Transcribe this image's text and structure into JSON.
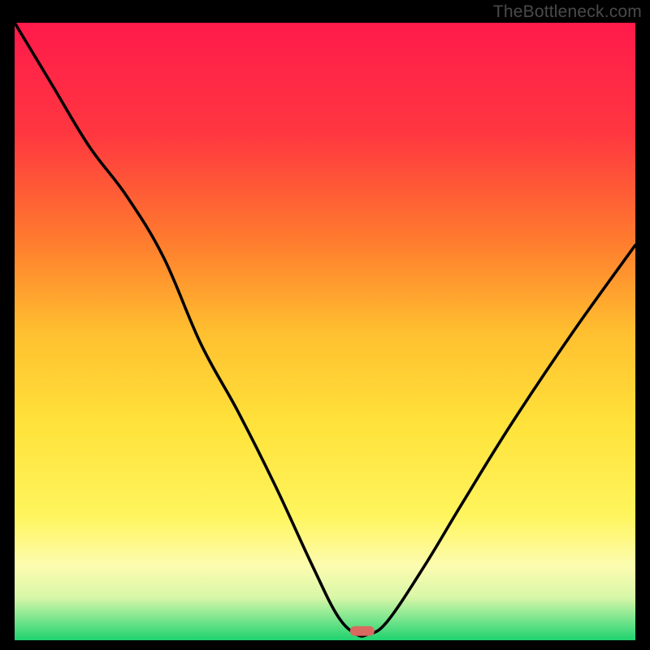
{
  "watermark": "TheBottleneck.com",
  "chart_data": {
    "type": "line",
    "title": "",
    "xlabel": "",
    "ylabel": "",
    "xlim": [
      0,
      100
    ],
    "ylim": [
      0,
      100
    ],
    "x": [
      0,
      6,
      12,
      18,
      24,
      30,
      36,
      42,
      48,
      52,
      55,
      57,
      60,
      66,
      72,
      80,
      90,
      100
    ],
    "values": [
      100,
      90,
      80,
      72,
      62,
      48,
      37,
      25,
      12,
      4,
      1,
      1,
      3,
      12,
      22,
      35,
      50,
      64
    ],
    "gradient_stops": [
      {
        "offset": 0,
        "color": "#ff1a4b"
      },
      {
        "offset": 18,
        "color": "#ff3740"
      },
      {
        "offset": 35,
        "color": "#ff7a2e"
      },
      {
        "offset": 50,
        "color": "#ffbf2f"
      },
      {
        "offset": 65,
        "color": "#ffe23a"
      },
      {
        "offset": 80,
        "color": "#fff55e"
      },
      {
        "offset": 88,
        "color": "#fcfcb0"
      },
      {
        "offset": 93,
        "color": "#d9f7a8"
      },
      {
        "offset": 97,
        "color": "#6fe38a"
      },
      {
        "offset": 100,
        "color": "#1ed26e"
      }
    ],
    "marker": {
      "x": 56,
      "y": 1.5,
      "color": "#d96a60"
    }
  }
}
